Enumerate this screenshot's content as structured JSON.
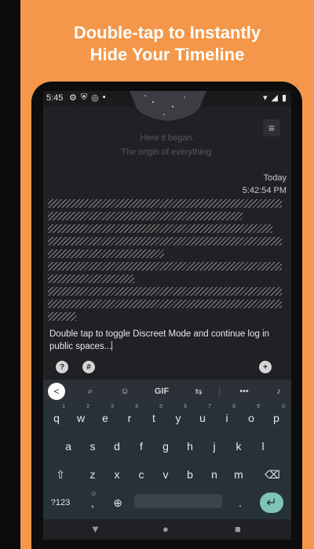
{
  "headline": {
    "line1": "Double-tap to Instantly",
    "line2": "Hide Your Timeline"
  },
  "colors": {
    "background": "#f4974a",
    "screen": "#202124",
    "keyboard": "#263238",
    "enter": "#7ec4b4"
  },
  "statusbar": {
    "time": "5:45",
    "left_icons": [
      "gear-icon",
      "shield-icon",
      "sync-icon",
      "sd-card-icon"
    ],
    "right_icons": [
      "wifi-icon",
      "signal-icon",
      "battery-icon"
    ]
  },
  "app": {
    "menu_icon": "menu-icon",
    "origin_line1": "Here it began.",
    "origin_line2": "The origin of everything.",
    "entry_date": "Today",
    "entry_time": "5:42:54 PM",
    "compose_text": "Double tap to toggle Discreet Mode and continue log in public spaces...",
    "help_button": "?",
    "tag_button": "#",
    "add_button": "+"
  },
  "keyboard": {
    "toolbar": {
      "back": "<",
      "gif": "GIF",
      "items": [
        "search-icon",
        "sticker-icon",
        "gif",
        "translate-icon",
        "more-icon",
        "mic-icon"
      ]
    },
    "row1": [
      "q",
      "w",
      "e",
      "r",
      "t",
      "y",
      "u",
      "i",
      "o",
      "p"
    ],
    "row1_hints": [
      "1",
      "2",
      "3",
      "4",
      "5",
      "6",
      "7",
      "8",
      "9",
      "0"
    ],
    "row2": [
      "a",
      "s",
      "d",
      "f",
      "g",
      "h",
      "j",
      "k",
      "l"
    ],
    "row3": [
      "z",
      "x",
      "c",
      "v",
      "b",
      "n",
      "m"
    ],
    "symbols_key": "?123",
    "comma_key": ",",
    "emoji_hint": "☺",
    "period_key": "."
  },
  "navbar": {
    "back": "▼",
    "home": "●",
    "recents": "■"
  }
}
